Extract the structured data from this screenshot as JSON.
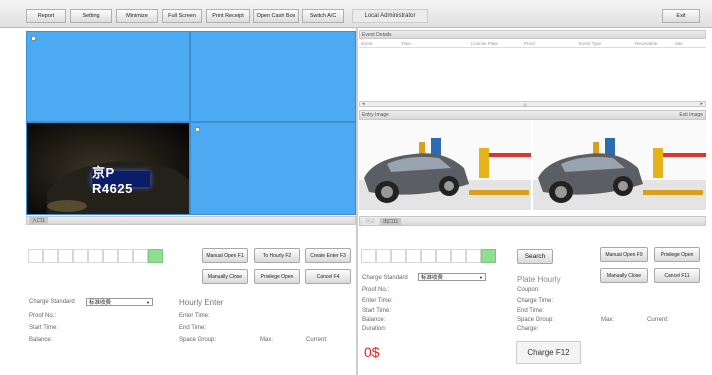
{
  "toolbar": {
    "buttons": [
      "Report",
      "Setting",
      "Minimize",
      "Full Screen",
      "Print Receipt",
      "Open Cash Box",
      "Switch A/C"
    ],
    "user": "Local Administrator",
    "exit": "Exit"
  },
  "lane_left": {
    "label": "入口1",
    "plate": "京P R4625",
    "buttons": {
      "manual_open": "Manual Open F1",
      "to_hourly": "To Hourly F2",
      "create_enter": "Create Enter F3",
      "manually_close": "Manually Close",
      "privilege_open": "Privilege Open",
      "cancel": "Cancel F4"
    },
    "charge_standard_label": "Charge Standard",
    "charge_standard_value": "标准收费",
    "proof_no": "Proof No.:",
    "start_time": "Start Time:",
    "balance": "Balance:",
    "hourly_title": "Hourly Enter",
    "enter_time": "Enter Time:",
    "end_time": "End Time:",
    "space_group": "Space Group:",
    "max": "Max:",
    "current": "Current:"
  },
  "event_details": {
    "title": "Event Details",
    "columns": [
      "Event",
      "Time",
      "License Plate",
      "Proof",
      "Event Type",
      "Receivable",
      "Site"
    ]
  },
  "images": {
    "entry": "Entry Image",
    "exit": "Exit Image"
  },
  "lane_right": {
    "tabs": [
      "测试",
      "出口11"
    ],
    "search": "Search",
    "buttons": {
      "manual_open": "Manual Open F9",
      "privilege_open": "Privilege Open",
      "manually_close": "Manually Close",
      "cancel": "Cancel F11"
    },
    "charge_standard_label": "Charge Standard",
    "charge_standard_value": "标准收费",
    "proof_no": "Proof No.:",
    "enter_time": "Enter Time:",
    "start_time": "Start Time:",
    "balance": "Balance:",
    "duration": "Duration:",
    "amount": "0$",
    "plate_hourly": "Plate Hourly",
    "coupon": "Coupon:",
    "charge_time": "Charge Time:",
    "end_time": "End Time:",
    "space_group": "Space Group:",
    "charge": "Charge:",
    "max": "Max:",
    "current": "Current:",
    "charge_btn": "Charge F12"
  },
  "colors": {
    "camera_bg": "#4baaf2",
    "amount": "#e8241a",
    "green_cell": "#8ee08e"
  }
}
